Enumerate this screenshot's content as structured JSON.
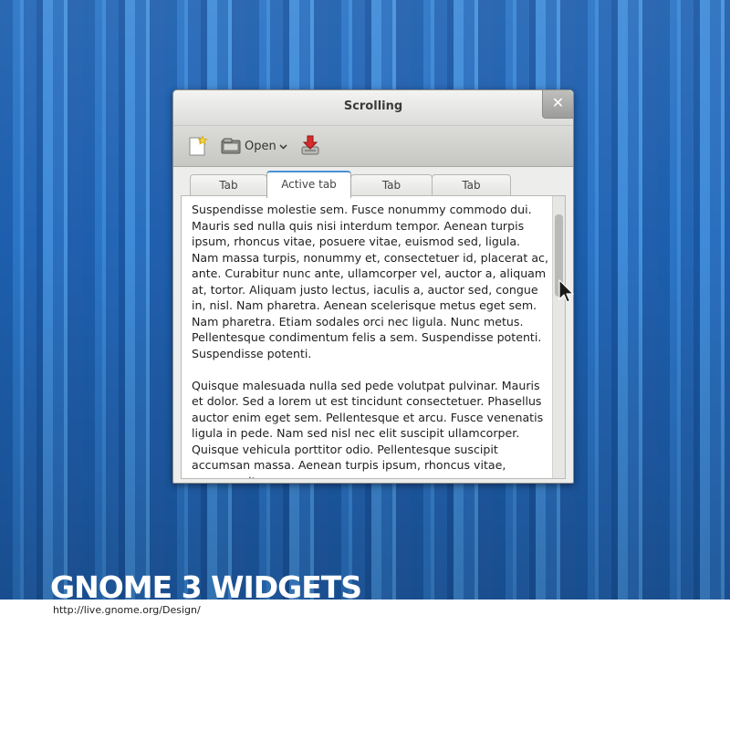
{
  "wallpaper": {
    "title": "GNOME 3 WIDGETS",
    "url": "http://live.gnome.org/Design/"
  },
  "window": {
    "title": "Scrolling",
    "close_label": "✕",
    "toolbar": {
      "new_icon": "new-document-icon",
      "open_label": "Open",
      "open_icon": "open-folder-icon",
      "save_icon": "save-download-icon"
    },
    "tabs": [
      {
        "label": "Tab",
        "active": false
      },
      {
        "label": "Active tab",
        "active": true
      },
      {
        "label": "Tab",
        "active": false
      },
      {
        "label": "Tab",
        "active": false
      }
    ],
    "content": {
      "paragraphs": [
        "Suspendisse molestie sem. Fusce nonummy commodo dui. Mauris sed nulla quis nisi interdum tempor. Aenean turpis ipsum, rhoncus vitae, posuere vitae, euismod sed, ligula. Nam massa turpis, nonummy et, consectetuer id, placerat ac, ante. Curabitur nunc ante, ullamcorper vel, auctor a, aliquam at, tortor. Aliquam justo lectus, iaculis a, auctor sed, congue in, nisl. Nam pharetra. Aenean scelerisque metus eget sem. Nam pharetra. Etiam sodales orci nec ligula. Nunc metus. Pellentesque condimentum felis a sem. Suspendisse potenti. Suspendisse potenti.",
        "Quisque malesuada nulla sed pede volutpat pulvinar. Mauris et dolor. Sed a lorem ut est tincidunt consectetuer. Phasellus auctor enim eget sem. Pellentesque et arcu. Fusce venenatis ligula in pede. Nam sed nisl nec elit suscipit ullamcorper. Quisque vehicula porttitor odio. Pellentesque suscipit accumsan massa. Aenean turpis ipsum, rhoncus vitae, posuere vitae,"
      ]
    }
  },
  "colors": {
    "accent": "#4a90d9",
    "wallpaper_blue": "#2466b6"
  }
}
